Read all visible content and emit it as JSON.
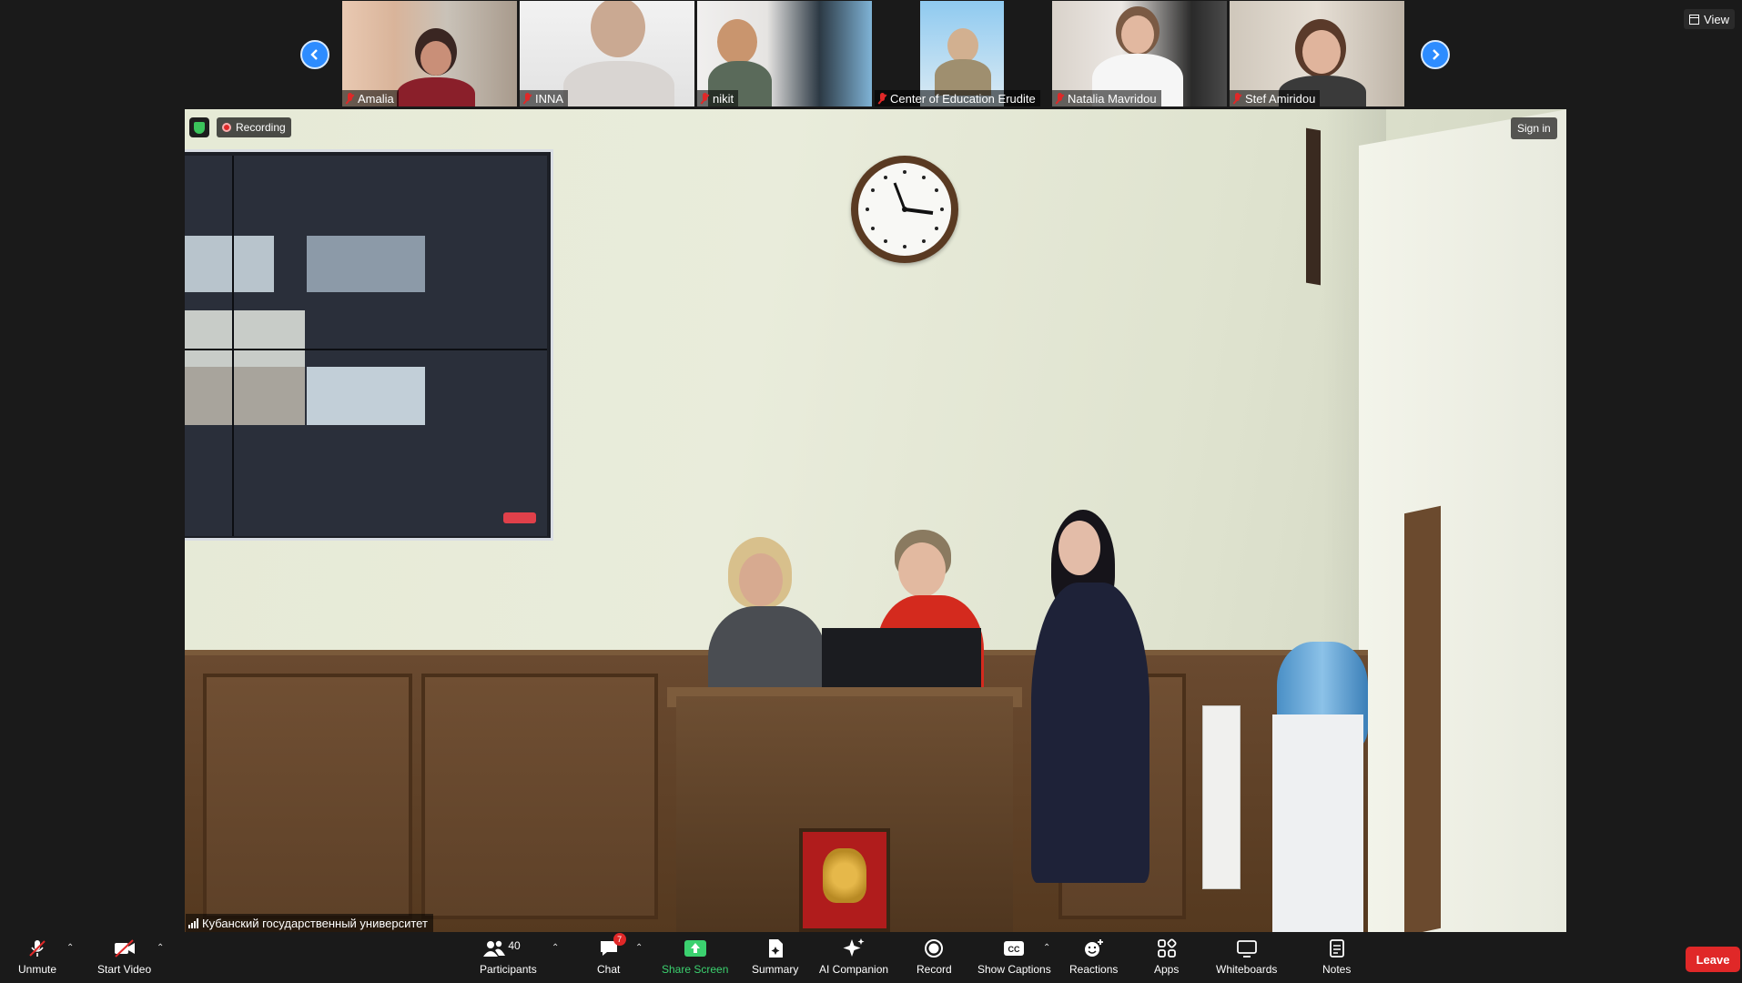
{
  "top_strip": {
    "participants": [
      {
        "name": "Amalia",
        "muted": true
      },
      {
        "name": "INNA",
        "muted": true
      },
      {
        "name": "nikit",
        "muted": true
      },
      {
        "name": "Center of Education Erudite",
        "muted": true
      },
      {
        "name": "Natalia Mavridou",
        "muted": true
      },
      {
        "name": "Stef Amiridou",
        "muted": true
      }
    ],
    "prev_icon": "chevron-left-icon",
    "next_icon": "chevron-right-icon"
  },
  "view": {
    "label": "View",
    "icon": "grid-view-icon"
  },
  "meeting": {
    "recording_label": "Recording",
    "sign_in_label": "Sign in",
    "active_speaker": "Кубанский государственный университет"
  },
  "toolbar": {
    "unmute": "Unmute",
    "start_video": "Start Video",
    "participants": "Participants",
    "participants_count": "40",
    "chat": "Chat",
    "chat_badge": "7",
    "share_screen": "Share Screen",
    "summary": "Summary",
    "ai_companion": "AI Companion",
    "record": "Record",
    "show_captions": "Show Captions",
    "reactions": "Reactions",
    "apps": "Apps",
    "whiteboards": "Whiteboards",
    "notes": "Notes",
    "leave": "Leave"
  },
  "colors": {
    "accent": "#2d8cff",
    "leave": "#e02828",
    "share_green": "#3bd16f",
    "background": "#1a1a1a"
  }
}
